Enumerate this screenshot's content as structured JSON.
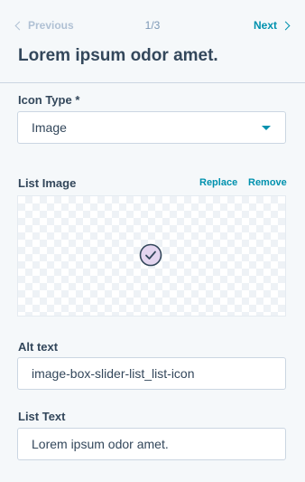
{
  "nav": {
    "previous_label": "Previous",
    "counter": "1/3",
    "next_label": "Next"
  },
  "title": "Lorem ipsum odor amet.",
  "icon_type": {
    "label": "Icon Type *",
    "value": "Image"
  },
  "list_image": {
    "label": "List Image",
    "replace_label": "Replace",
    "remove_label": "Remove",
    "icon": "check-circle-icon"
  },
  "alt_text": {
    "label": "Alt text",
    "value": "image-box-slider-list_list-icon"
  },
  "list_text": {
    "label": "List Text",
    "value": "Lorem ipsum odor amet."
  },
  "colors": {
    "background": "#f5f8fa",
    "text": "#33475b",
    "link": "#0091ae",
    "disabled": "#b0c1d4",
    "border": "#cbd6e2",
    "check_fill": "#e3d5ef"
  }
}
